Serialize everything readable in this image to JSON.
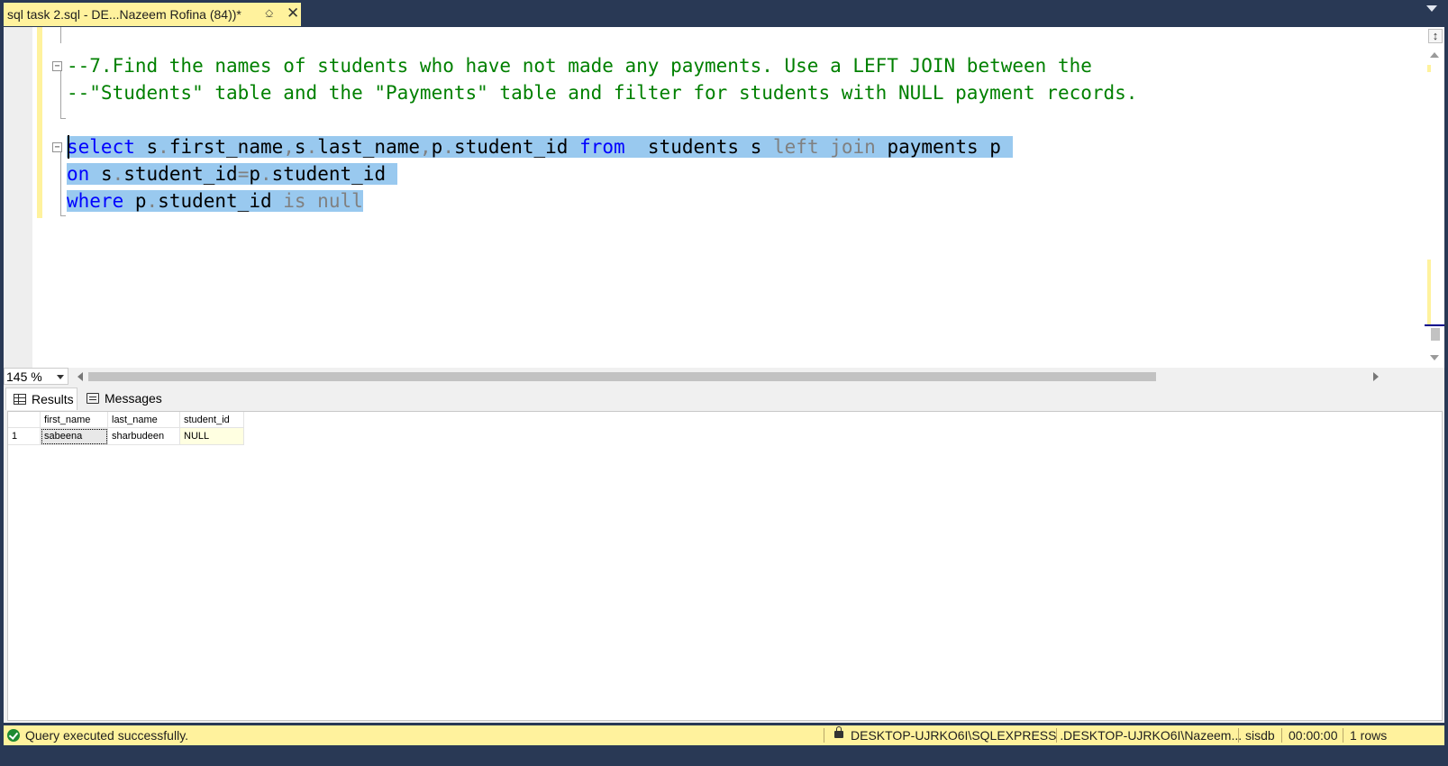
{
  "tab": {
    "title": "sql task 2.sql - DE...Nazeem Rofina (84))*",
    "pin_icon": "pin-icon",
    "close_icon": "close-icon"
  },
  "editor": {
    "comment_line1": "--7.Find the names of students who have not made any payments. Use a LEFT JOIN between the",
    "comment_line2": "--\"Students\" table and the \"Payments\" table and filter for students with NULL payment records.",
    "query": {
      "line1": {
        "select": "select",
        "a": " s",
        "dot1": ".",
        "b": "first_name",
        "comma1": ",",
        "c": "s",
        "dot2": ".",
        "d": "last_name",
        "comma2": ",",
        "e": "p",
        "dot3": ".",
        "f": "student_id ",
        "from": "from",
        "g": "  students s ",
        "left_join": "left join",
        "h": " payments p "
      },
      "line2": {
        "on": "on",
        "a": " s",
        "dot1": ".",
        "b": "student_id",
        "eq": "=",
        "c": "p",
        "dot2": ".",
        "d": "student_id "
      },
      "line3": {
        "where": "where",
        "a": " p",
        "dot1": ".",
        "b": "student_id ",
        "is_null": "is null"
      }
    }
  },
  "zoom": {
    "value": "145 %"
  },
  "results_tabs": {
    "results": "Results",
    "messages": "Messages"
  },
  "results_grid": {
    "columns": [
      "first_name",
      "last_name",
      "student_id"
    ],
    "rows": [
      {
        "num": "1",
        "cells": [
          "sabeena",
          "sharbudeen",
          "NULL"
        ]
      }
    ]
  },
  "status_bar": {
    "message": "Query executed successfully.",
    "server": "DESKTOP-UJRKO6I\\SQLEXPRESS ...",
    "user": "DESKTOP-UJRKO6I\\Nazeem...",
    "database": "sisdb",
    "elapsed": "00:00:00",
    "rows": "1 rows",
    "accent_color": "#fff29d"
  }
}
